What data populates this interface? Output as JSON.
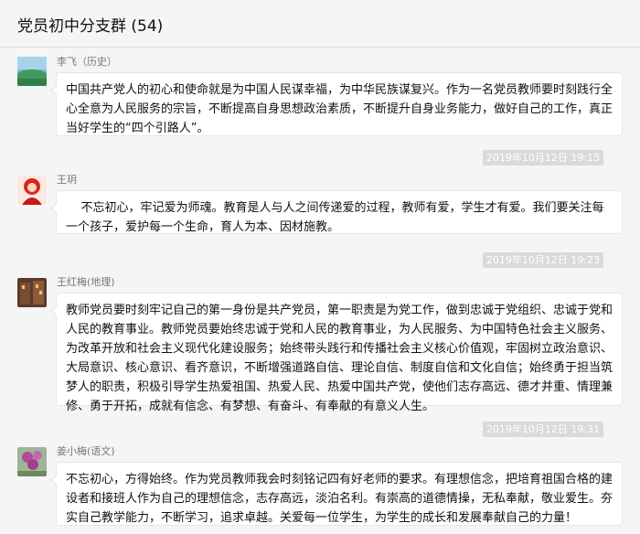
{
  "window": {
    "title": "党员初中分支群 (54)"
  },
  "messages": [
    {
      "sender": "李飞（历史）",
      "avatar": "landscape-avatar",
      "text": "中国共产党人的初心和使命就是为中国人民谋幸福，为中华民族谋复兴。作为一名党员教师要时刻践行全心全意为人民服务的宗旨，不断提高自身思想政治素质，不断提升自身业务能力，做好自己的工作，真正当好学生的“四个引路人”。",
      "time": "2019年10月12日 19:15"
    },
    {
      "sender": "王玥",
      "avatar": "red-figure-avatar",
      "text": "    不忘初心，牢记爱为师魂。教育是人与人之间传递爱的过程，教师有爱，学生才有爱。我们要关注每一个孩子，爱护每一个生命，育人为本、因材施教。",
      "time": "2019年10月12日 19:23"
    },
    {
      "sender": "王红梅(地理)",
      "avatar": "building-avatar",
      "text": "教师党员要时刻牢记自己的第一身份是共产党员，第一职责是为党工作，做到忠诚于党组织、忠诚于党和人民的教育事业。教师党员要始终忠诚于党和人民的教育事业，为人民服务、为中国特色社会主义服务、为改革开放和社会主义现代化建设服务；始终带头践行和传播社会主义核心价值观，牢固树立政治意识、大局意识、核心意识、看齐意识，不断增强道路自信、理论自信、制度自信和文化自信；始终勇于担当筑梦人的职责，积极引导学生热爱祖国、热爱人民、热爱中国共产党，使他们志存高远、德才并重、情理兼修、勇于开拓，成就有信念、有梦想、有奋斗、有奉献的有意义人生。",
      "time": "2019年10月12日 19:31"
    },
    {
      "sender": "姜小梅(语文)",
      "avatar": "flower-avatar",
      "text": "不忘初心，方得始终。作为党员教师我会时刻铭记四有好老师的要求。有理想信念，把培育祖国合格的建设者和接班人作为自己的理想信念，志存高远，淡泊名利。有崇高的道德情操，无私奉献，敬业爱生。夯实自己教学能力，不断学习，追求卓越。关爱每一位学生，为学生的成长和发展奉献自己的力量！"
    }
  ]
}
